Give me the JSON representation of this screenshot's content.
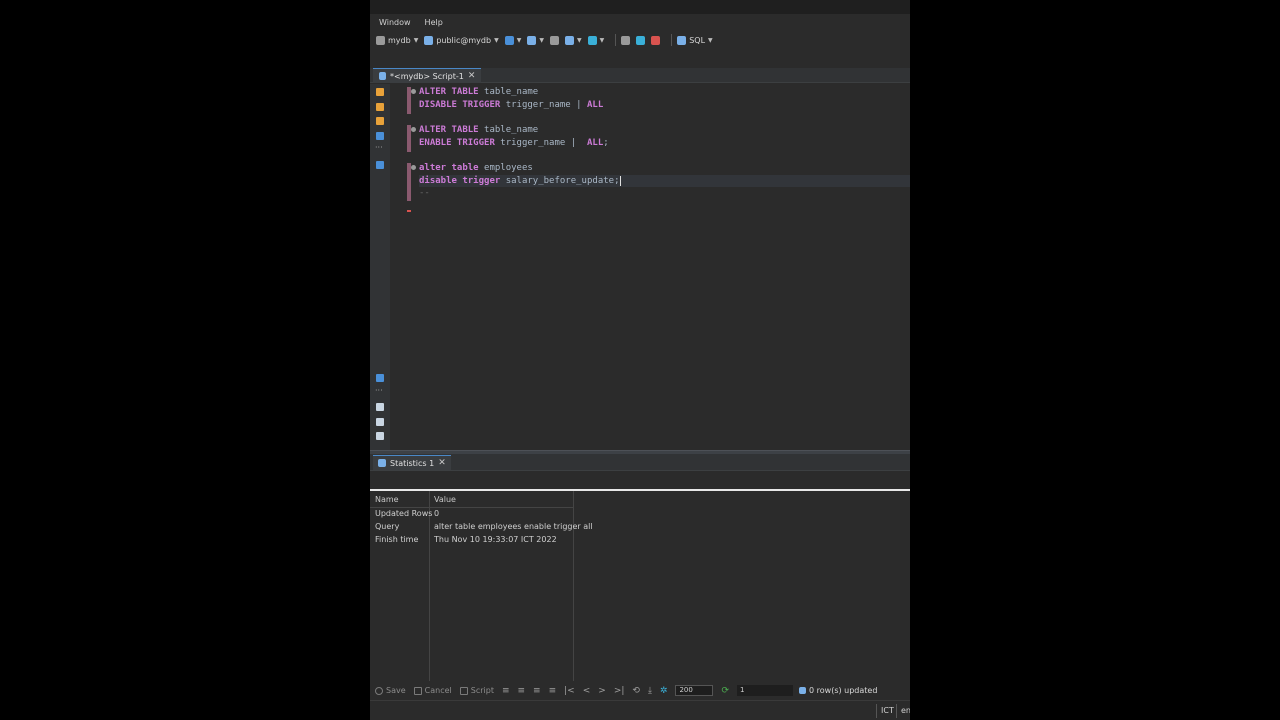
{
  "menu": [
    "Window",
    "Help"
  ],
  "toolbar": {
    "connection": "mydb",
    "schema": "public@mydb",
    "sql_label": "SQL"
  },
  "editor_tab": {
    "title": "*<mydb> Script-1"
  },
  "code": {
    "l1a": "ALTER TABLE",
    "l1b": " table_name",
    "l2a": "DISABLE TRIGGER",
    "l2b": " trigger_name | ",
    "l2c": "ALL",
    "l3a": "ALTER TABLE",
    "l3b": " table_name",
    "l4a": "ENABLE TRIGGER",
    "l4b": " trigger_name |  ",
    "l4c": "ALL",
    "l4d": ";",
    "l5a": "alter table",
    "l5b": " employees",
    "l6a": "disable trigger",
    "l6b": " salary_before_update;",
    "l7": "--"
  },
  "results_tab": {
    "title": "Statistics 1"
  },
  "results": {
    "col_name": "Name",
    "col_value": "Value",
    "rows": [
      {
        "name": "Updated Rows",
        "value": "0"
      },
      {
        "name": "Query",
        "value": "alter table employees enable trigger all"
      },
      {
        "name": "Finish time",
        "value": "Thu Nov 10 19:33:07 ICT 2022"
      }
    ]
  },
  "bottom_toolbar": {
    "save": "Save",
    "cancel": "Cancel",
    "script": "Script",
    "fetch_size": "200",
    "row_number": "1",
    "status": "0 row(s) updated"
  },
  "statusbar": {
    "timezone": "ICT",
    "locale": "en"
  },
  "colors": {
    "keyword": "#cc7bd6",
    "background": "#2b2b2b",
    "accent": "#4a88c7"
  }
}
